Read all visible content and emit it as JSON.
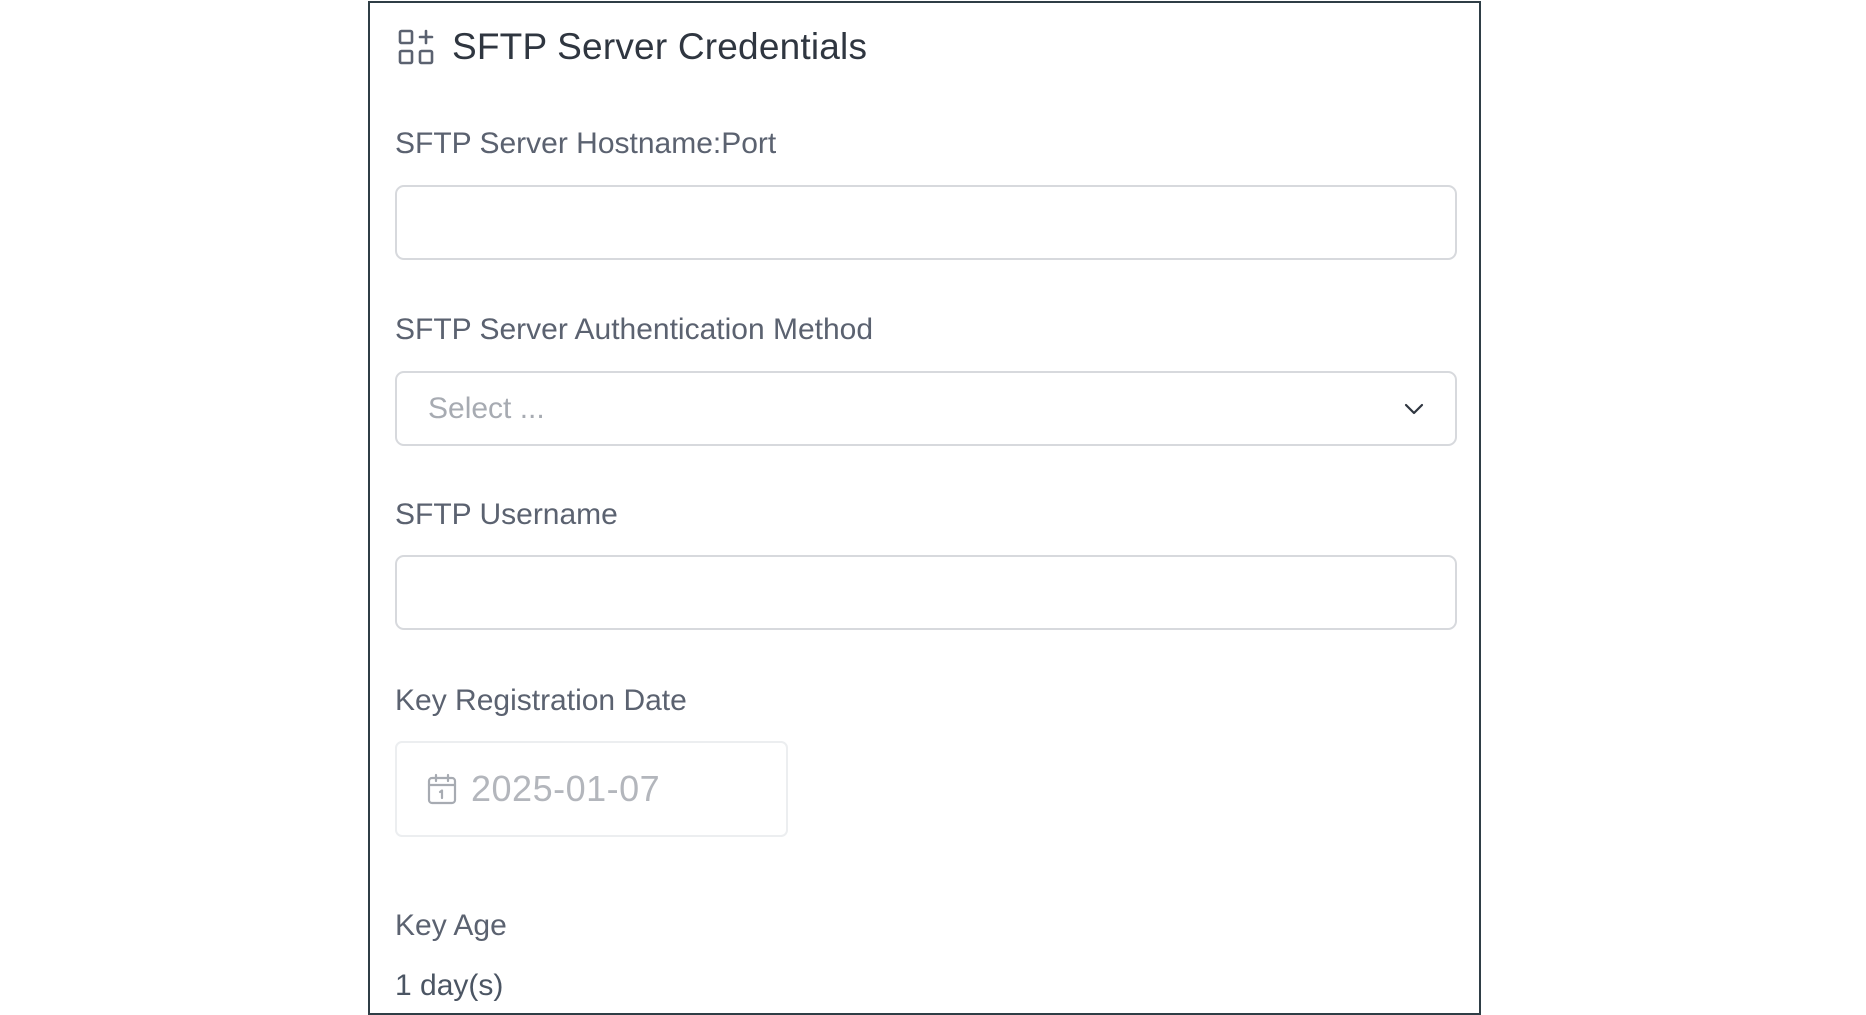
{
  "panel": {
    "title": "SFTP Server Credentials",
    "title_icon": "widget-add-icon"
  },
  "fields": {
    "hostname": {
      "label": "SFTP Server Hostname:Port",
      "value": ""
    },
    "auth_method": {
      "label": "SFTP Server Authentication Method",
      "placeholder": "Select ...",
      "icon": "chevron-down-icon"
    },
    "username": {
      "label": "SFTP Username",
      "value": ""
    },
    "key_registration_date": {
      "label": "Key Registration Date",
      "value": "2025-01-07",
      "icon": "calendar-icon"
    },
    "key_age": {
      "label": "Key Age",
      "value": "1 day(s)"
    }
  },
  "colors": {
    "border": "#2f3e46",
    "input_border": "#d7d9dd",
    "label_text": "#5b6270",
    "placeholder_text": "#a7abb2"
  }
}
